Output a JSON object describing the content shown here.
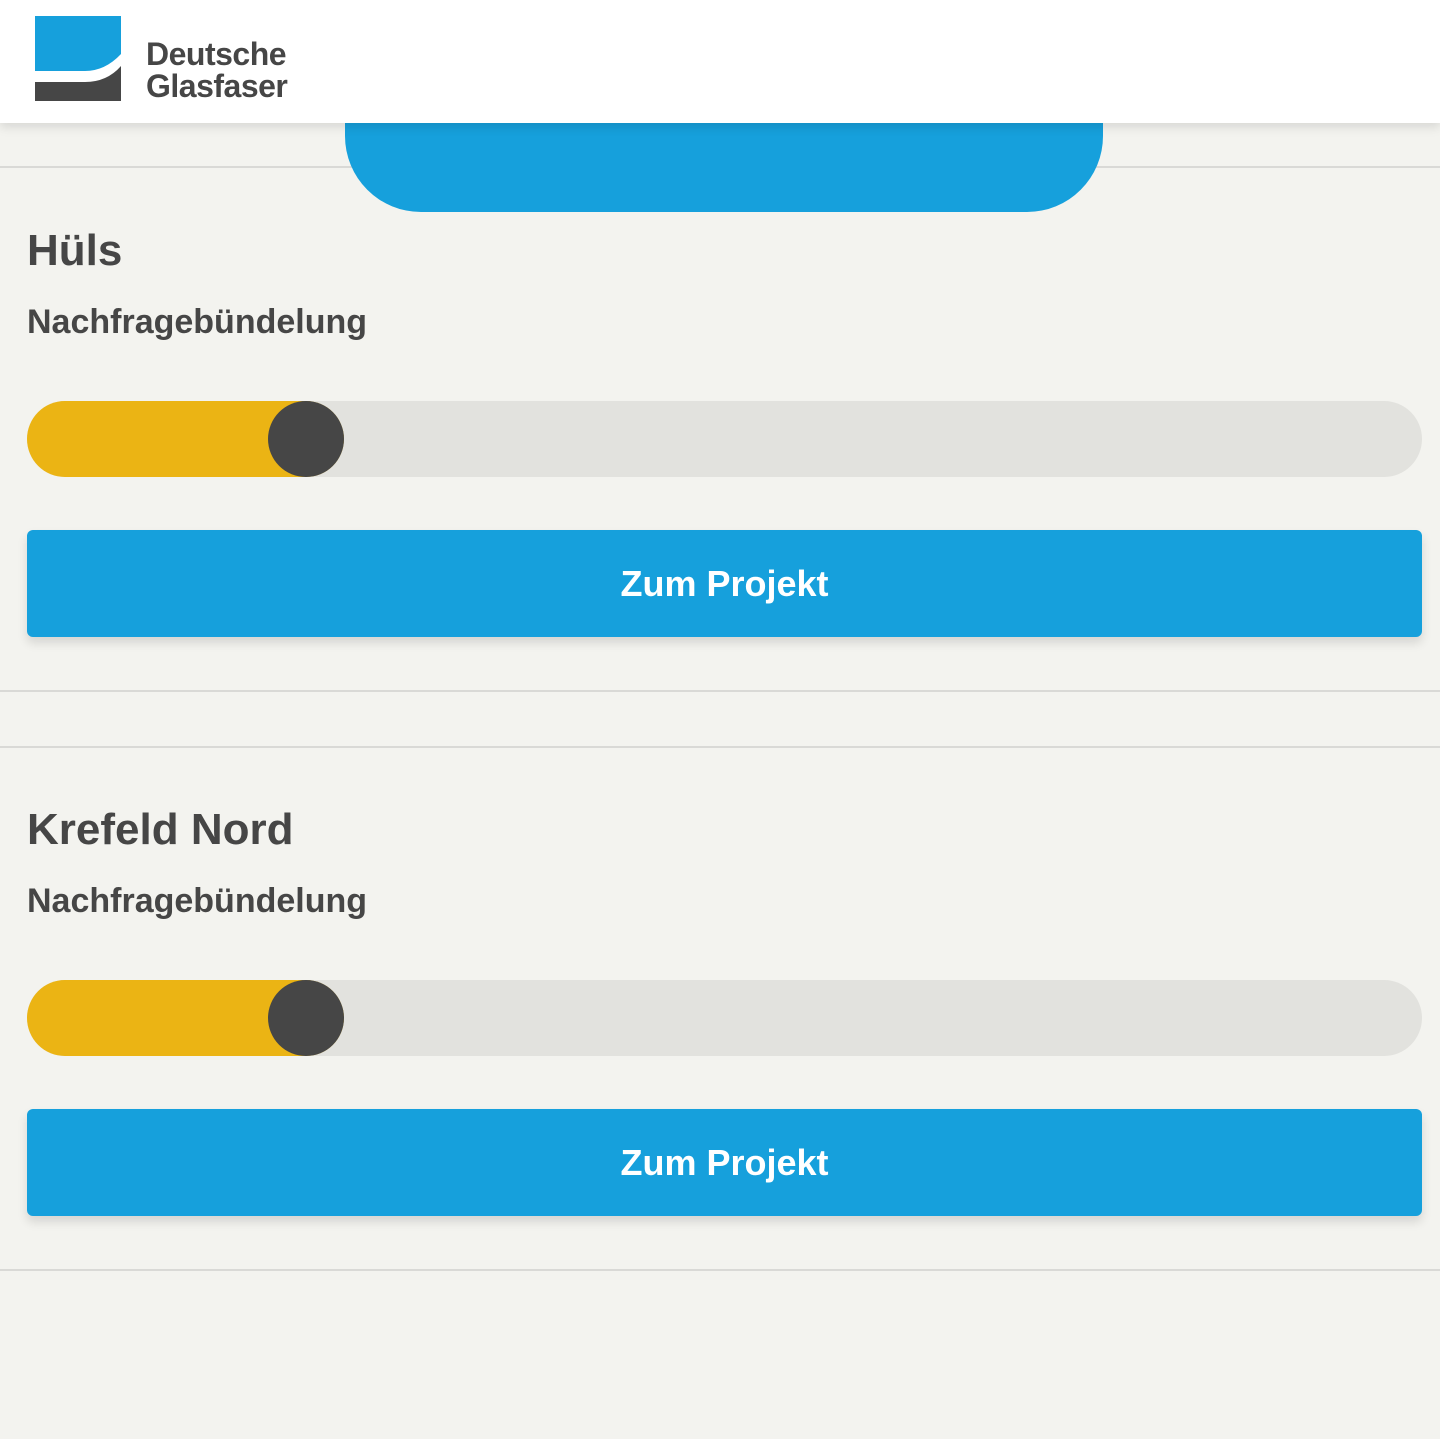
{
  "header": {
    "brand_line1": "Deutsche",
    "brand_line2": "Glasfaser",
    "logo_icon": "deutsche-glasfaser-logo",
    "colors": {
      "brand_blue": "#16a0dc",
      "brand_dark": "#464646"
    }
  },
  "projects": [
    {
      "title": "Hüls",
      "status": "Nachfragebündelung",
      "progress_percent": 20,
      "button_label": "Zum Projekt"
    },
    {
      "title": "Krefeld Nord",
      "status": "Nachfragebündelung",
      "progress_percent": 20,
      "button_label": "Zum Projekt"
    }
  ],
  "colors": {
    "progress_fill": "#ebb414",
    "progress_track": "#e2e2de",
    "progress_knob": "#464646",
    "button": "#16a0dc",
    "background": "#f3f3ef"
  }
}
